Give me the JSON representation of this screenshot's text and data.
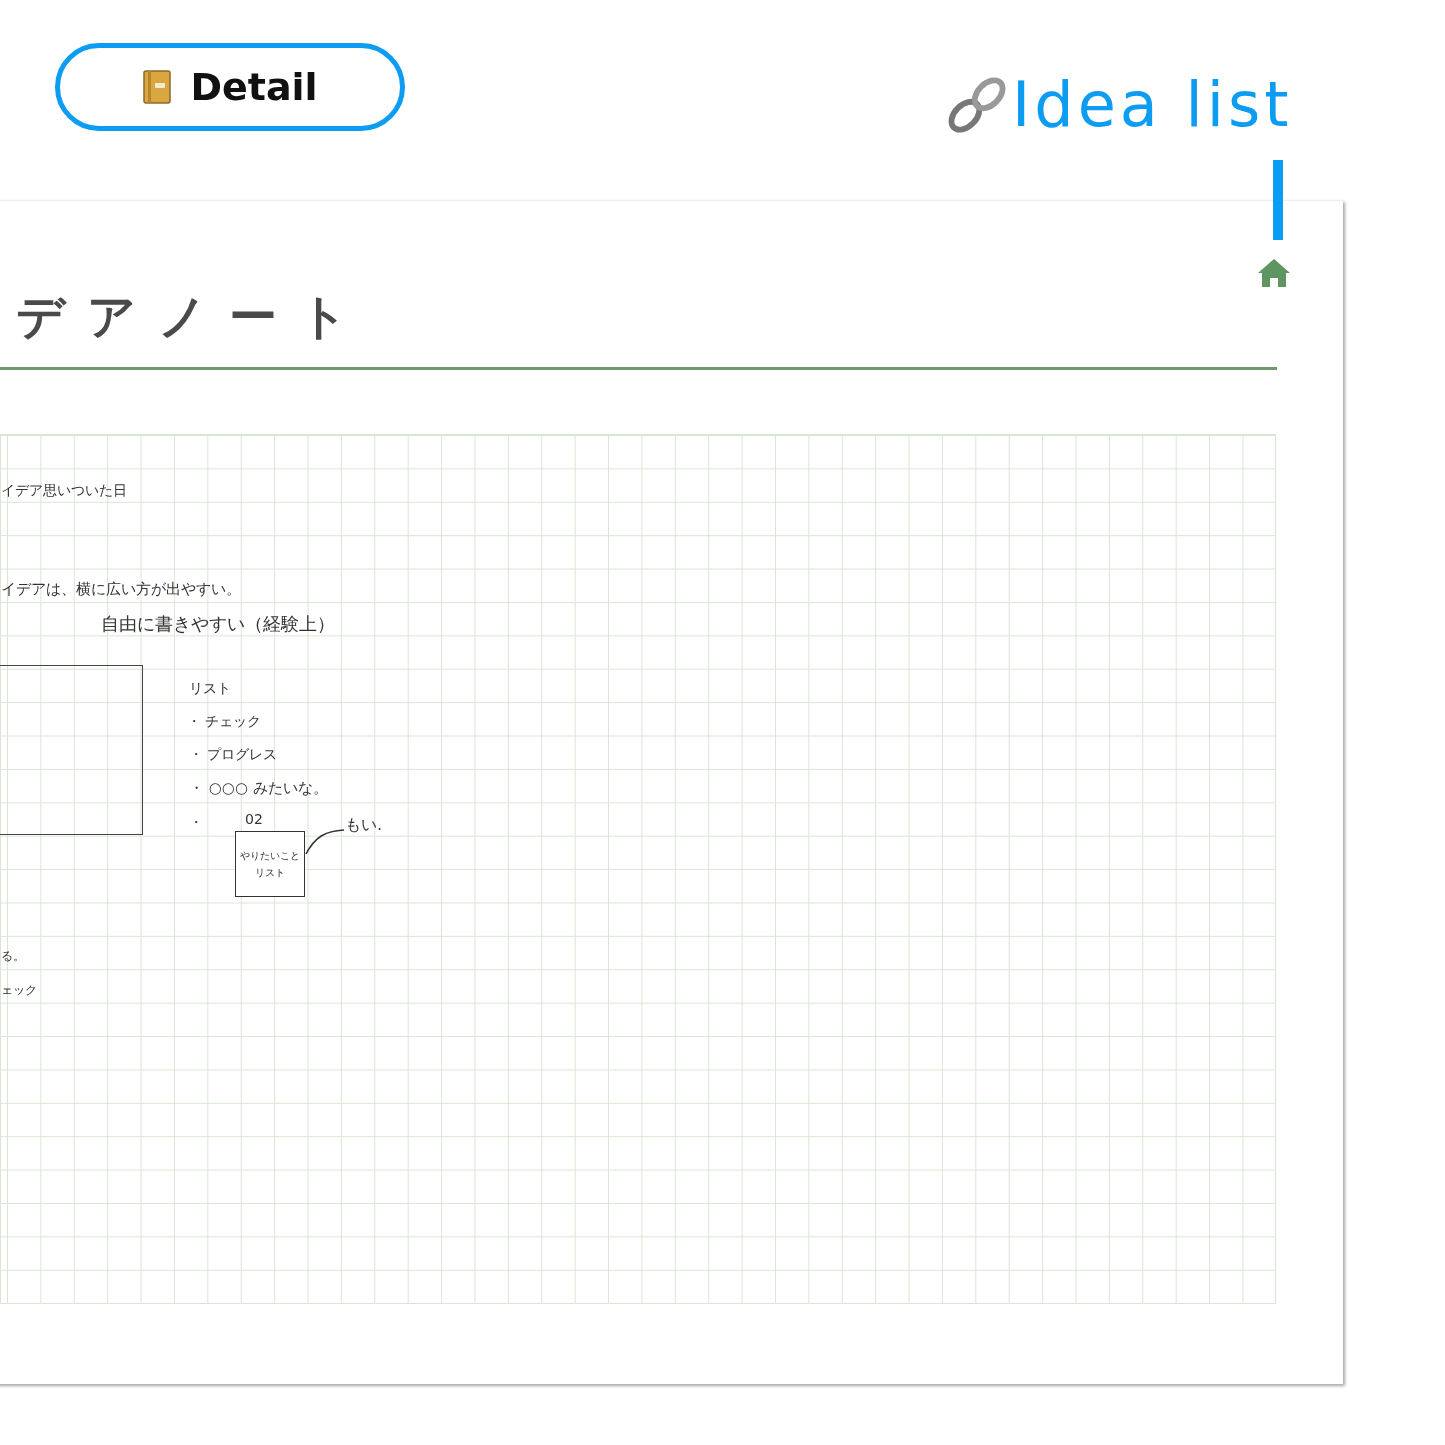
{
  "header": {
    "detail_button": "Detail",
    "link_title": "Idea list"
  },
  "note": {
    "title": "デアノート",
    "lines": [
      "イデア思いついた日",
      "イデアは、横に広い方が出やすい。",
      "自由に書きやすい（経験上）",
      "リスト",
      "・ チェック",
      "・ プログレス",
      "・ ○○○ みたいな。",
      "・",
      "もい.",
      "る。",
      "ェック"
    ],
    "sketch": {
      "number": "02",
      "caption_lines": [
        "やりたいこと",
        "リスト"
      ]
    }
  }
}
